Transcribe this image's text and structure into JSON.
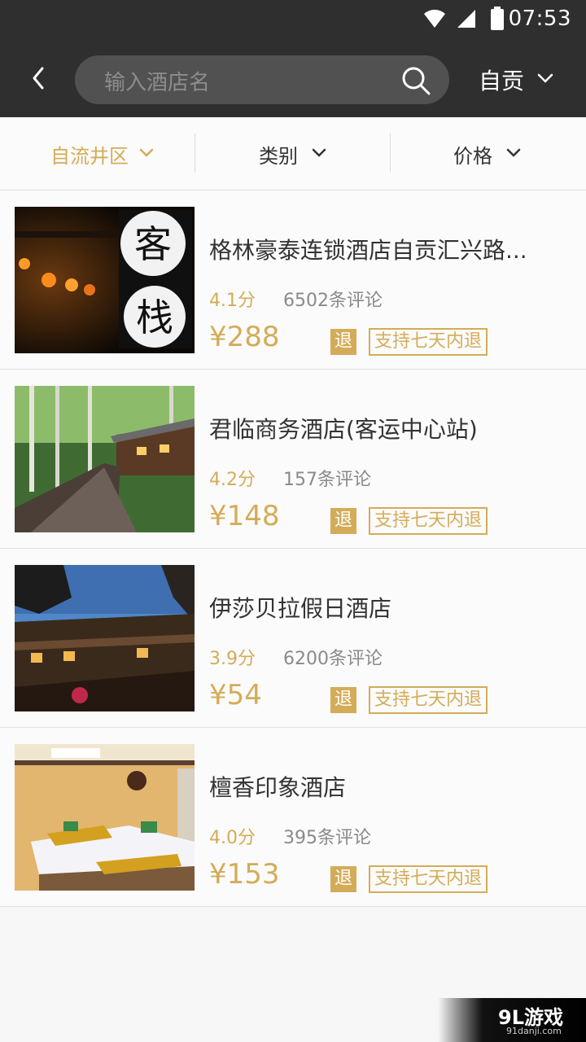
{
  "status_bar": {
    "time": "07:53",
    "icons": [
      "wifi-icon",
      "signal-icon",
      "battery-icon"
    ]
  },
  "header": {
    "search_placeholder": "输入酒店名",
    "city": "自贡"
  },
  "filters": [
    {
      "label": "自流井区",
      "active": true
    },
    {
      "label": "类别",
      "active": false
    },
    {
      "label": "价格",
      "active": false
    }
  ],
  "hotels": [
    {
      "name": "格林豪泰连锁酒店自贡汇兴路...",
      "score": "4.1分",
      "reviews": "6502条评论",
      "price": "¥288",
      "refund_badge": "退",
      "refund_text": "支持七天内退"
    },
    {
      "name": "君临商务酒店(客运中心站)",
      "score": "4.2分",
      "reviews": "157条评论",
      "price": "¥148",
      "refund_badge": "退",
      "refund_text": "支持七天内退"
    },
    {
      "name": "伊莎贝拉假日酒店",
      "score": "3.9分",
      "reviews": "6200条评论",
      "price": "¥54",
      "refund_badge": "退",
      "refund_text": "支持七天内退"
    },
    {
      "name": "檀香印象酒店",
      "score": "4.0分",
      "reviews": "395条评论",
      "price": "¥153",
      "refund_badge": "退",
      "refund_text": "支持七天内退"
    }
  ],
  "thumbnail_text": {
    "sign_1": "客",
    "sign_2": "栈"
  },
  "watermark": {
    "main": "9L游戏",
    "sub": "91danji.com"
  },
  "colors": {
    "header_bg": "#2f2f2f",
    "accent_gold": "#d4ac58",
    "text_dark": "#333333",
    "text_gray": "#8a8a8a"
  }
}
